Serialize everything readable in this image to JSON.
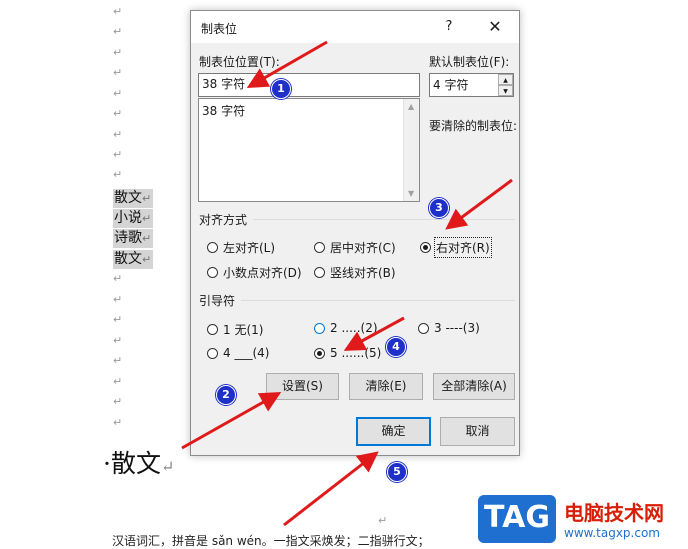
{
  "document": {
    "paragraph_mark": "↵",
    "highlighted_lines": [
      "散文",
      "小说",
      "诗歌",
      "散文"
    ],
    "heading": "·散文",
    "body_line": "汉语词汇，拼音是 sǎn wén。一指文采焕发；二指骈行文；"
  },
  "dialog": {
    "title": "制表位",
    "help": "?",
    "close": "✕",
    "tab_stop_position_label": "制表位位置(T):",
    "tab_stop_position_value": "38 字符",
    "tab_list_items": [
      "38 字符"
    ],
    "default_tab_label": "默认制表位(F):",
    "default_tab_value": "4 字符",
    "clear_label": "要清除的制表位:",
    "alignment": {
      "title": "对齐方式",
      "options": [
        "左对齐(L)",
        "居中对齐(C)",
        "右对齐(R)",
        "小数点对齐(D)",
        "竖线对齐(B)"
      ],
      "selected": "右对齐(R)"
    },
    "leader": {
      "title": "引导符",
      "options": [
        "1 无(1)",
        "2 .....(2)",
        "3 ----(3)",
        "4 ___(4)",
        "5 ......(5)"
      ],
      "selected": "5 ......(5)"
    },
    "buttons": {
      "set": "设置(S)",
      "clear": "清除(E)",
      "clear_all": "全部清除(A)",
      "ok": "确定",
      "cancel": "取消"
    }
  },
  "annotations": {
    "badges": [
      "1",
      "2",
      "3",
      "4",
      "5"
    ],
    "arrow_color": "#e0191b",
    "badge_color": "#1f2fc9"
  },
  "watermark": {
    "logo_text": "TAG",
    "site_name": "电脑技术网",
    "url": "www.tagxp.com"
  }
}
